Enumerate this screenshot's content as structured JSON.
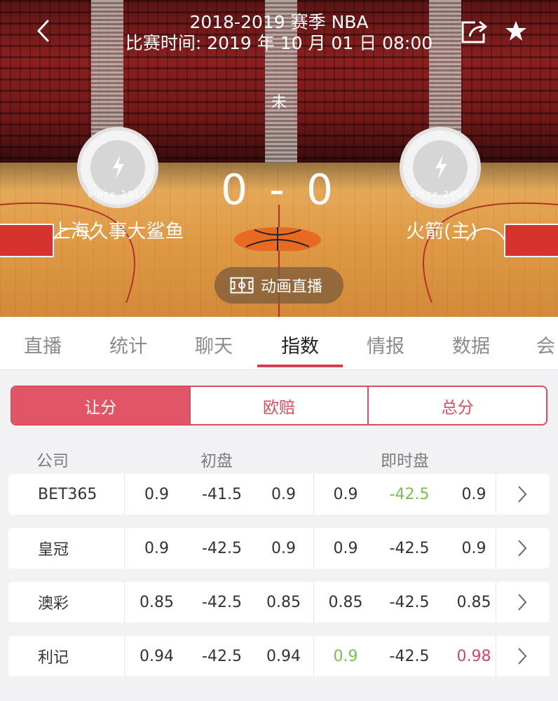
{
  "header": {
    "season": "2018-2019 赛季 NBA",
    "match_time": "比赛时间: 2019 年 10 月 01 日 08:00"
  },
  "match": {
    "status": "未",
    "score": "0 - 0",
    "home_team": "上海久事大鲨鱼",
    "away_team": "火箭(主)",
    "badge_text": "since 2015",
    "animation_button": "动画直播"
  },
  "tabs": [
    "直播",
    "统计",
    "聊天",
    "指数",
    "情报",
    "数据",
    "会"
  ],
  "active_tab": "指数",
  "segments": [
    "让分",
    "欧赔",
    "总分"
  ],
  "active_segment": "让分",
  "table": {
    "headers": {
      "company": "公司",
      "initial": "初盘",
      "live": "即时盘"
    },
    "rows": [
      {
        "company": "BET365",
        "values": [
          "0.9",
          "-41.5",
          "0.9",
          "0.9",
          "-42.5",
          "0.9"
        ],
        "colors": [
          "",
          "",
          "",
          "",
          "#7bbf4a",
          ""
        ]
      },
      {
        "company": "皇冠",
        "values": [
          "0.9",
          "-42.5",
          "0.9",
          "0.9",
          "-42.5",
          "0.9"
        ],
        "colors": [
          "",
          "",
          "",
          "",
          "",
          ""
        ]
      },
      {
        "company": "澳彩",
        "values": [
          "0.85",
          "-42.5",
          "0.85",
          "0.85",
          "-42.5",
          "0.85"
        ],
        "colors": [
          "",
          "",
          "",
          "",
          "",
          ""
        ]
      },
      {
        "company": "利记",
        "values": [
          "0.94",
          "-42.5",
          "0.94",
          "0.9",
          "-42.5",
          "0.98"
        ],
        "colors": [
          "",
          "",
          "",
          "#7bbf4a",
          "",
          "#d0495b"
        ]
      }
    ]
  },
  "colors": {
    "accent": "#dd4b5f",
    "up": "#7bbf4a",
    "down": "#d0495b"
  },
  "icons": [
    "back-icon",
    "share-icon",
    "star-icon",
    "lightning-icon",
    "court-icon",
    "chevron-right-icon"
  ]
}
